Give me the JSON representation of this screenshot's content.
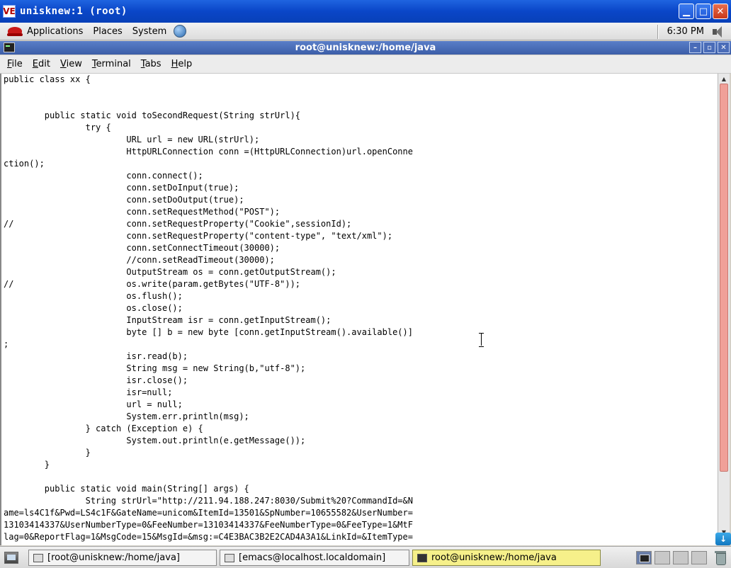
{
  "outer_window": {
    "icon_text": "VE",
    "title": "unisknew:1 (root)",
    "minimize": "▁",
    "maximize": "□",
    "close": "✕"
  },
  "top_panel": {
    "menus": [
      "Applications",
      "Places",
      "System"
    ],
    "clock": "6:30 PM"
  },
  "terminal": {
    "title": "root@unisknew:/home/java",
    "menus": [
      {
        "label": "File"
      },
      {
        "label": "Edit"
      },
      {
        "label": "View"
      },
      {
        "label": "Terminal"
      },
      {
        "label": "Tabs"
      },
      {
        "label": "Help"
      }
    ],
    "lines": [
      "public class xx {",
      "",
      "",
      "        public static void toSecondRequest(String strUrl){",
      "                try {",
      "                        URL url = new URL(strUrl);",
      "                        HttpURLConnection conn =(HttpURLConnection)url.openConne",
      "ction();",
      "                        conn.connect();",
      "                        conn.setDoInput(true);",
      "                        conn.setDoOutput(true);",
      "                        conn.setRequestMethod(\"POST\");",
      "//                      conn.setRequestProperty(\"Cookie\",sessionId);",
      "                        conn.setRequestProperty(\"content-type\", \"text/xml\");",
      "                        conn.setConnectTimeout(30000);",
      "                        //conn.setReadTimeout(30000);",
      "                        OutputStream os = conn.getOutputStream();",
      "//                      os.write(param.getBytes(\"UTF-8\"));",
      "                        os.flush();",
      "                        os.close();",
      "                        InputStream isr = conn.getInputStream();",
      "                        byte [] b = new byte [conn.getInputStream().available()]",
      ";",
      "                        isr.read(b);",
      "                        String msg = new String(b,\"utf-8\");",
      "                        isr.close();",
      "                        isr=null;",
      "                        url = null;",
      "                        System.err.println(msg);",
      "                } catch (Exception e) {",
      "                        System.out.println(e.getMessage());",
      "                }",
      "        }",
      "",
      "        public static void main(String[] args) {",
      "                String strUrl=\"http://211.94.188.247:8030/Submit%20?CommandId=&N",
      "ame=ls4C1f&Pwd=LS4c1F&GateName=unicom&ItemId=13501&SpNumber=10655582&UserNumber=",
      "13103414337&UserNumberType=0&FeeNumber=13103414337&FeeNumberType=0&FeeType=1&MtF",
      "lag=0&ReportFlag=1&MsgCode=15&MsgId=&msg:=C4E3BAC3B2E2CAD4A3A1&LinkId=&ItemType="
    ]
  },
  "taskbar": {
    "tasks": [
      {
        "label": "[root@unisknew:/home/java]",
        "active": false
      },
      {
        "label": "[emacs@localhost.localdomain]",
        "active": false
      },
      {
        "label": "root@unisknew:/home/java",
        "active": true
      }
    ]
  }
}
